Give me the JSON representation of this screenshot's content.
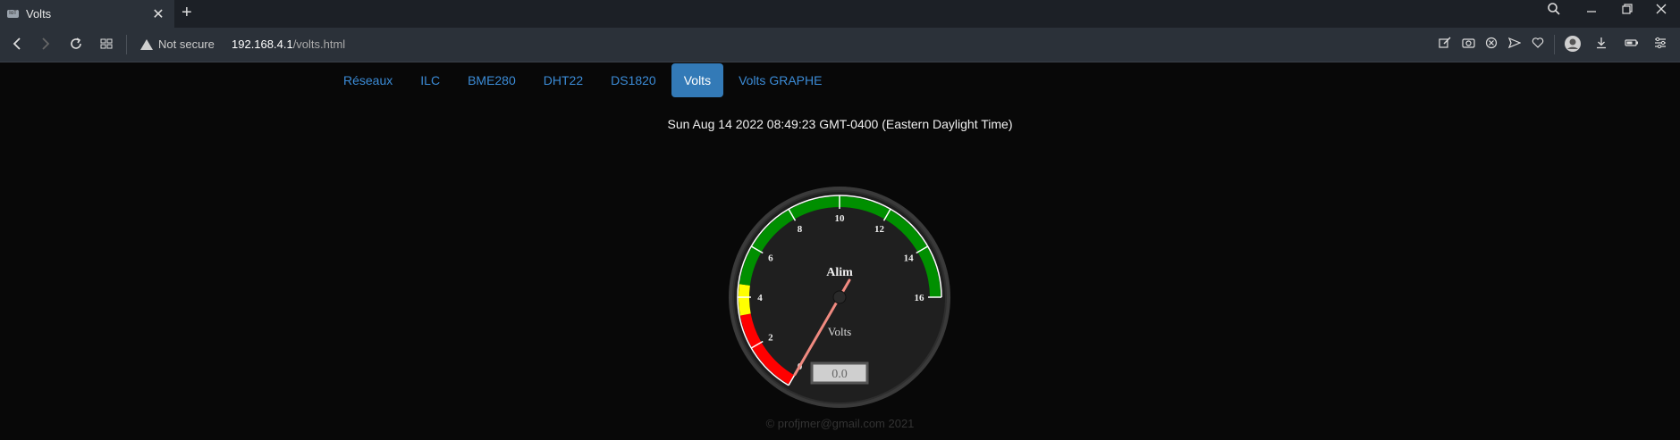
{
  "browser": {
    "tab_title": "Volts",
    "favicon_text": "IoT",
    "close_glyph": "✕",
    "newtab_glyph": "+",
    "security_label": "Not secure",
    "url_host": "192.168.4.1",
    "url_path": "/volts.html",
    "icons": [
      "back-icon",
      "forward-icon",
      "reload-icon",
      "tabs-grid-icon",
      "search-icon",
      "minimize-icon",
      "restore-icon",
      "close-icon",
      "edit-icon",
      "camera-icon",
      "block-icon",
      "send-icon",
      "heart-icon",
      "profile-icon",
      "download-icon",
      "battery-icon",
      "settings-icon"
    ]
  },
  "nav": {
    "tabs": [
      {
        "label": "Réseaux",
        "active": false
      },
      {
        "label": "ILC",
        "active": false
      },
      {
        "label": "BME280",
        "active": false
      },
      {
        "label": "DHT22",
        "active": false
      },
      {
        "label": "DS1820",
        "active": false
      },
      {
        "label": "Volts",
        "active": true
      },
      {
        "label": "Volts GRAPHE",
        "active": false
      }
    ]
  },
  "datetime": "Sun Aug 14 2022 08:49:23 GMT-0400 (Eastern Daylight Time)",
  "gauge": {
    "title": "Alim",
    "unit": "Volts",
    "value": 0.0,
    "display_value": "0.0",
    "min": 0,
    "max": 16,
    "tick_labels": [
      "0",
      "2",
      "4",
      "6",
      "8",
      "10",
      "12",
      "14",
      "16"
    ],
    "zones": [
      {
        "from": 0,
        "to": 3.3,
        "color": "#ff0000"
      },
      {
        "from": 3.3,
        "to": 4.5,
        "color": "#ffff00"
      },
      {
        "from": 4.5,
        "to": 16,
        "color": "#008f00"
      }
    ],
    "needle_color": "#f08a80"
  },
  "footer": "© profjmer@gmail.com 2021"
}
